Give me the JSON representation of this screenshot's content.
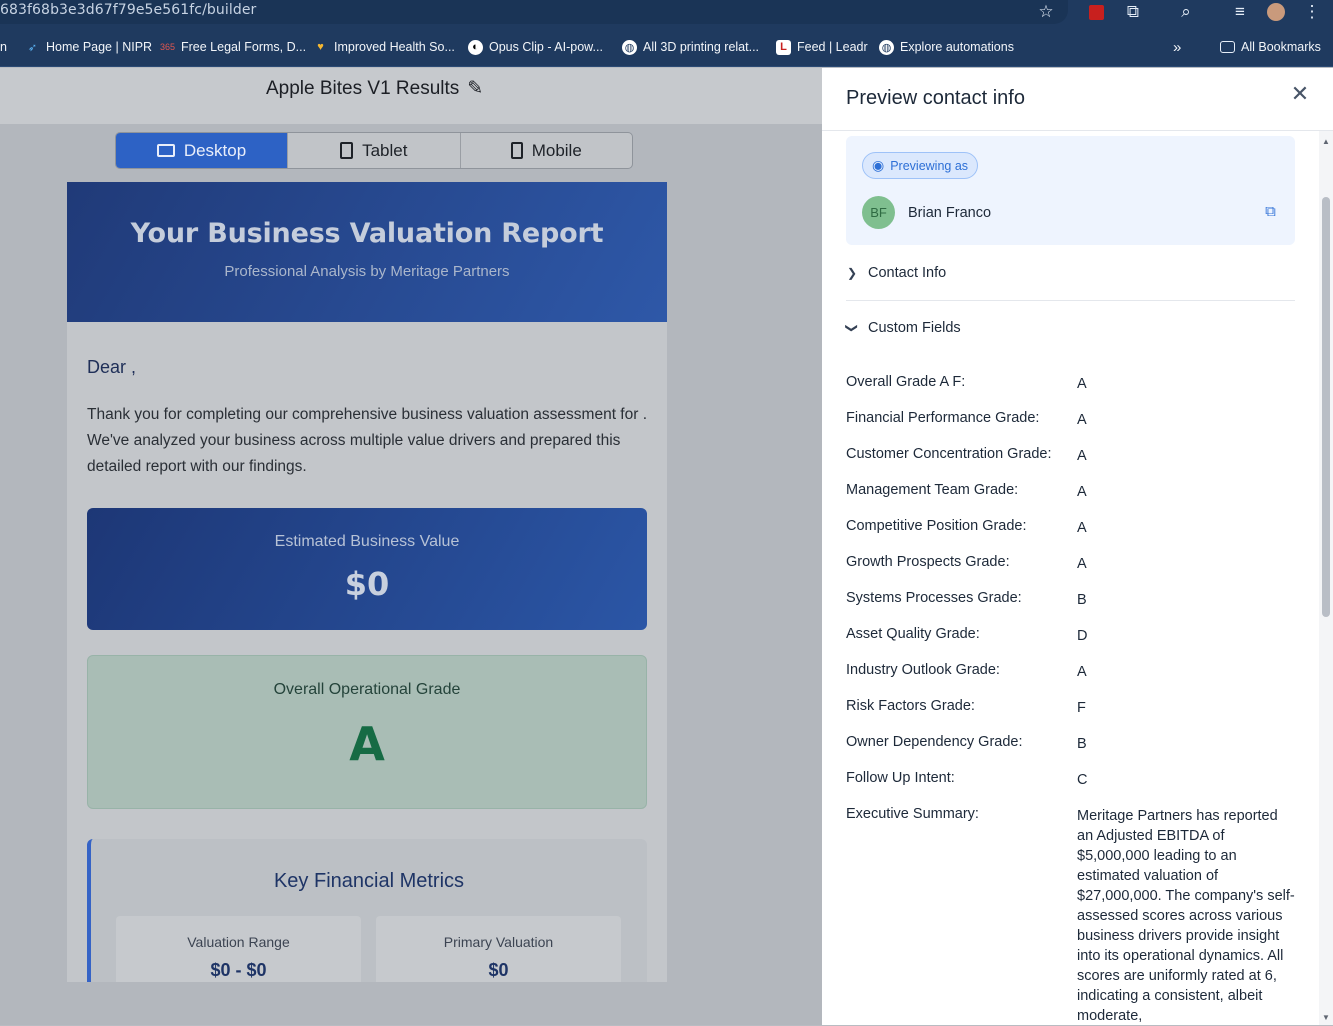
{
  "browser": {
    "url": "683f68b3e3d67f79e5e561fc/builder",
    "bookmarks": [
      {
        "label": "n",
        "icon": "truncated"
      },
      {
        "label": "Home Page | NIPR",
        "icon": "nipr-icon"
      },
      {
        "label": "Free Legal Forms, D...",
        "icon": "legal-forms-icon"
      },
      {
        "label": "Improved Health So...",
        "icon": "heart-shield-icon"
      },
      {
        "label": "Opus Clip - AI-pow...",
        "icon": "opus-clip-icon"
      },
      {
        "label": "All 3D printing relat...",
        "icon": "globe-icon"
      },
      {
        "label": "Feed | Leadr",
        "icon": "leadr-icon"
      },
      {
        "label": "Explore automations",
        "icon": "globe-icon"
      }
    ],
    "overflow_label": "»",
    "all_bookmarks_label": "All Bookmarks"
  },
  "builder": {
    "title": "Apple Bites V1 Results",
    "devices": [
      "Desktop",
      "Tablet",
      "Mobile"
    ],
    "active_device": "Desktop"
  },
  "email": {
    "heading": "Your Business Valuation Report",
    "subheading": "Professional Analysis by Meritage Partners",
    "greeting": "Dear ,",
    "intro": "Thank you for completing our comprehensive business valuation assessment for . We've analyzed your business across multiple value drivers and prepared this detailed report with our findings.",
    "value_label": "Estimated Business Value",
    "value": "$0",
    "grade_label": "Overall Operational Grade",
    "grade": "A",
    "metrics_title": "Key Financial Metrics",
    "metrics": [
      {
        "label": "Valuation Range",
        "value": "$0 - $0"
      },
      {
        "label": "Primary Valuation",
        "value": "$0"
      }
    ]
  },
  "drawer": {
    "title": "Preview contact info",
    "previewing_label": "Previewing as",
    "contact_initials": "BF",
    "contact_name": "Brian Franco",
    "contact_info_label": "Contact Info",
    "custom_fields_label": "Custom Fields",
    "fields": [
      {
        "key": "Overall Grade A F:",
        "value": "A"
      },
      {
        "key": "Financial Performance Grade:",
        "value": "A"
      },
      {
        "key": "Customer Concentration Grade:",
        "value": "A"
      },
      {
        "key": "Management Team Grade:",
        "value": "A"
      },
      {
        "key": "Competitive Position Grade:",
        "value": "A"
      },
      {
        "key": "Growth Prospects Grade:",
        "value": "A"
      },
      {
        "key": "Systems Processes Grade:",
        "value": "B"
      },
      {
        "key": "Asset Quality Grade:",
        "value": "D"
      },
      {
        "key": "Industry Outlook Grade:",
        "value": "A"
      },
      {
        "key": "Risk Factors Grade:",
        "value": "F"
      },
      {
        "key": "Owner Dependency Grade:",
        "value": "B"
      },
      {
        "key": "Follow Up Intent:",
        "value": "C"
      },
      {
        "key": "Executive Summary:",
        "value": "Meritage Partners has reported an Adjusted EBITDA of $5,000,000 leading to an estimated valuation of $27,000,000. The company's self-assessed scores across various business drivers provide insight into its operational dynamics. All scores are uniformly rated at 6, indicating a consistent, albeit moderate,"
      }
    ]
  },
  "colors": {
    "accent": "#2d6fd6",
    "browser_bar": "#1f3a5f",
    "grade_green": "#166b44"
  }
}
